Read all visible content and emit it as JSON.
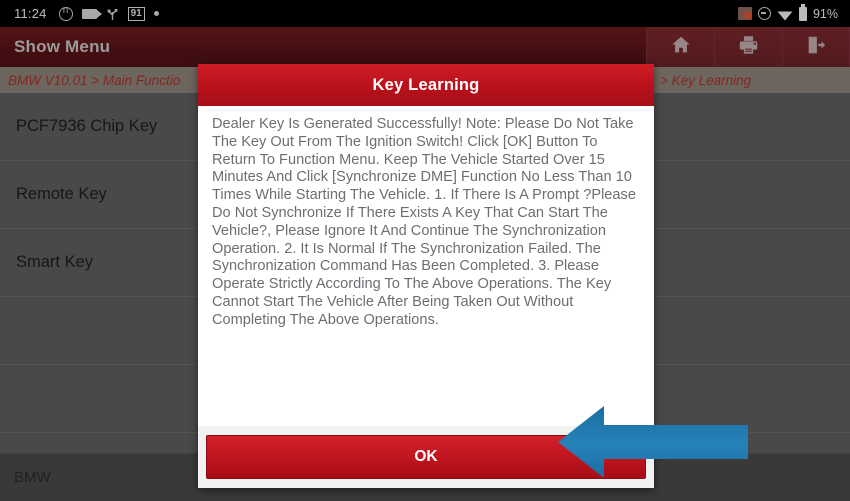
{
  "status_bar": {
    "clock": "11:24",
    "left_icons": [
      "circle-n-icon",
      "camera-icon",
      "usb-icon",
      "battery-badge-91-icon",
      "dot-icon"
    ],
    "badge_value": "91",
    "right_icons": [
      "screenshot-icon",
      "do-not-disturb-icon",
      "wifi-icon",
      "battery-icon"
    ],
    "battery_percent": "91%"
  },
  "titlebar": {
    "title": "Show Menu",
    "actions": [
      {
        "name": "home-icon",
        "label": "Home"
      },
      {
        "name": "print-icon",
        "label": "Print"
      },
      {
        "name": "exit-icon",
        "label": "Exit"
      }
    ]
  },
  "breadcrumb": {
    "left": "BMW V10.01 > Main Functio",
    "right": "> Key Learning"
  },
  "list": {
    "items": [
      {
        "label": "PCF7936 Chip Key"
      },
      {
        "label": "Remote Key"
      },
      {
        "label": "Smart Key"
      }
    ]
  },
  "bottom_bar": {
    "label": "BMW"
  },
  "dialog": {
    "title": "Key Learning",
    "body": "Dealer Key Is Generated Successfully!\nNote: Please Do Not Take The Key Out From The Ignition Switch!\nClick [OK] Button To Return To Function Menu.\nKeep The Vehicle Started Over 15 Minutes And Click [Synchronize DME] Function No Less Than 10 Times While Starting The Vehicle.\n1. If There Is A Prompt ?Please Do Not Synchronize If There Exists A Key That Can Start The Vehicle?, Please Ignore It And Continue The Synchronization Operation.\n2. It Is Normal If The Synchronization Failed. The Synchronization Command Has Been Completed.\n3. Please Operate Strictly According To The Above Operations. The Key Cannot Start The Vehicle After Being Taken Out Without Completing The Above Operations.",
    "ok_label": "OK"
  },
  "annotation": {
    "arrow": "left-arrow-annotation",
    "color": "#1f78ab"
  },
  "colors": {
    "titlebar": "#581418",
    "dialog_header": "#b9111b",
    "ok_button": "#c2161f",
    "breadcrumb_bg": "#8c8379",
    "breadcrumb_text": "#a8322e",
    "list_bg": "#5e5e5e",
    "arrow_blue": "#1f78ab"
  }
}
